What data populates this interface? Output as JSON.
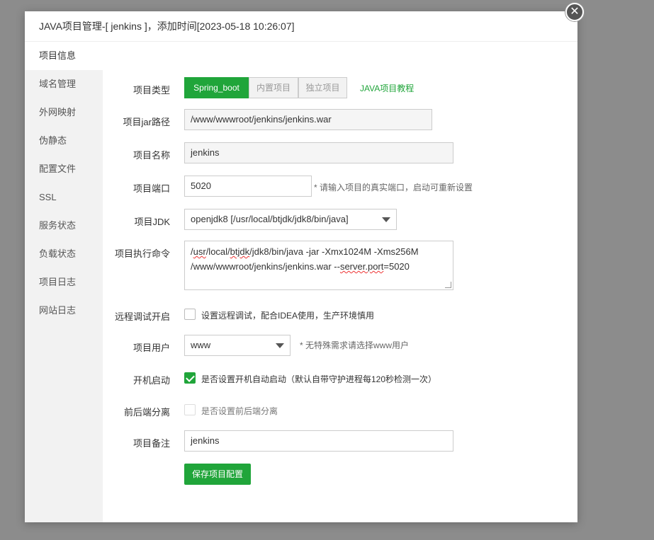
{
  "dialog": {
    "title": "JAVA项目管理-[ jenkins ]，添加时间[2023-05-18 10:26:07]",
    "close_icon": "close-icon"
  },
  "sidebar": {
    "items": [
      {
        "label": "项目信息",
        "active": true
      },
      {
        "label": "域名管理"
      },
      {
        "label": "外网映射"
      },
      {
        "label": "伪静态"
      },
      {
        "label": "配置文件"
      },
      {
        "label": "SSL"
      },
      {
        "label": "服务状态"
      },
      {
        "label": "负载状态"
      },
      {
        "label": "项目日志"
      },
      {
        "label": "网站日志"
      }
    ]
  },
  "form": {
    "project_type": {
      "label": "项目类型",
      "options": [
        "Spring_boot",
        "内置项目",
        "独立项目"
      ],
      "selected": "Spring_boot",
      "tutorial_link": "JAVA项目教程"
    },
    "jar_path": {
      "label": "项目jar路径",
      "value": "/www/wwwroot/jenkins/jenkins.war"
    },
    "name": {
      "label": "项目名称",
      "value": "jenkins"
    },
    "port": {
      "label": "项目端口",
      "value": "5020",
      "hint": "* 请输入项目的真实端口，启动可重新设置"
    },
    "jdk": {
      "label": "项目JDK",
      "value": "openjdk8 [/usr/local/btjdk/jdk8/bin/java]"
    },
    "command": {
      "label": "项目执行命令",
      "line1_a": "/",
      "line1_b": "usr",
      "line1_c": "/local/",
      "line1_d": "btjdk",
      "line1_e": "/jdk8/bin/java -jar -Xmx1024M -Xms256M",
      "line2_a": "/www/wwwroot/jenkins/jenkins.war --",
      "line2_b": "server.port",
      "line2_c": "=5020"
    },
    "remote_debug": {
      "label": "远程调试开启",
      "checkbox_label": "设置远程调试，配合IDEA使用，生产环境慎用",
      "checked": false
    },
    "user": {
      "label": "项目用户",
      "value": "www",
      "hint": "* 无特殊需求请选择www用户"
    },
    "autostart": {
      "label": "开机启动",
      "checkbox_label": "是否设置开机自动启动（默认自带守护进程每120秒检测一次）",
      "checked": true
    },
    "separation": {
      "label": "前后端分离",
      "checkbox_label": "是否设置前后端分离",
      "checked": false
    },
    "remark": {
      "label": "项目备注",
      "value": "jenkins"
    },
    "save_label": "保存项目配置"
  },
  "colors": {
    "accent": "#20a53a",
    "sidebar_bg": "#f2f2f2",
    "overlay": "#8c8c8c"
  }
}
